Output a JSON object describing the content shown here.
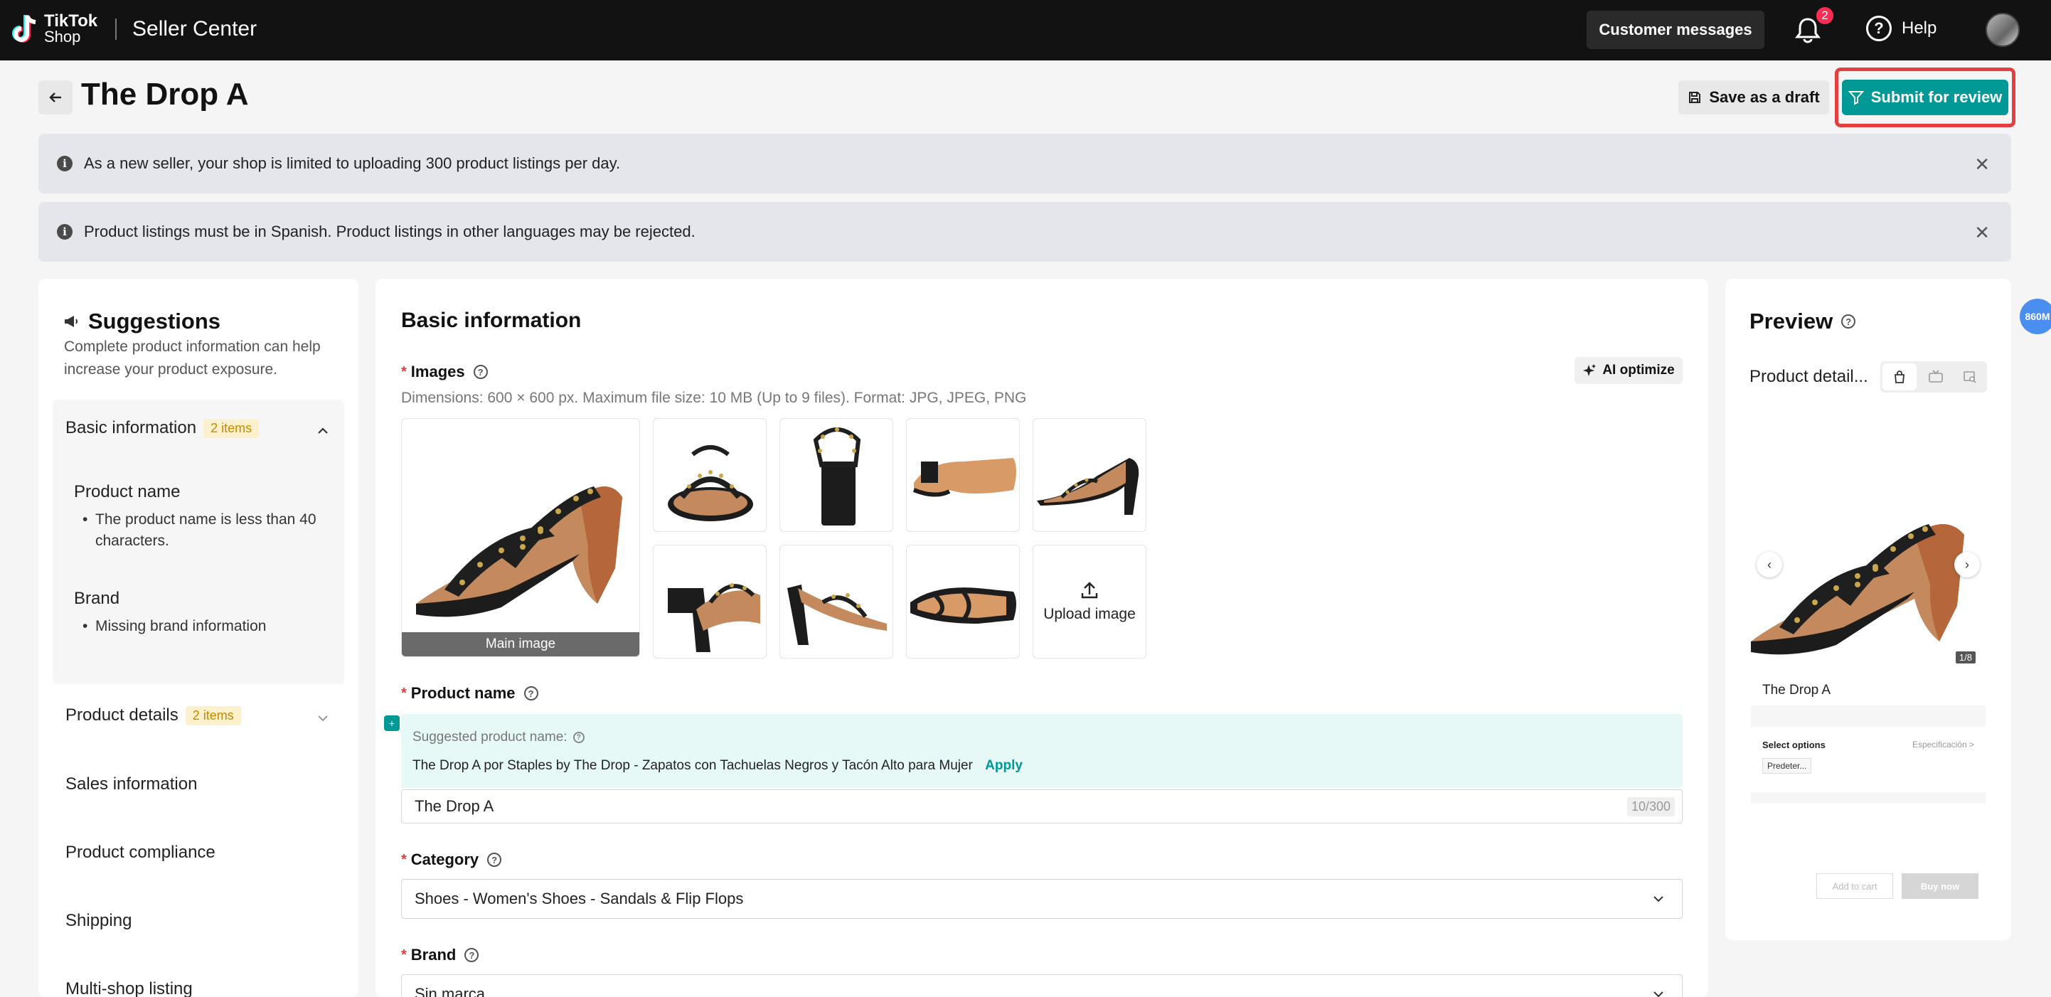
{
  "topbar": {
    "logo_line1": "TikTok",
    "logo_line2": "Shop",
    "app_name": "Seller Center",
    "customer_messages": "Customer messages",
    "notification_count": "2",
    "help": "Help",
    "bg_color": "#121212"
  },
  "header": {
    "title": "The Drop A",
    "save_draft": "Save as a draft",
    "submit": "Submit for review",
    "submit_color": "#009995",
    "highlight_color": "#e53e3e"
  },
  "banners": [
    {
      "text": "As a new seller, your shop is limited to uploading 300 product listings per day."
    },
    {
      "text": "Product listings must be in Spanish. Product listings in other languages may be rejected."
    }
  ],
  "suggestions": {
    "title": "Suggestions",
    "subtitle": "Complete product information can help increase your product exposure.",
    "basic": {
      "label": "Basic information",
      "badge": "2 items",
      "product_name_heading": "Product name",
      "product_name_tip": "The product name is less than 40 characters.",
      "brand_heading": "Brand",
      "brand_tip": "Missing brand information"
    },
    "product_details": {
      "label": "Product details",
      "badge": "2 items"
    },
    "nav": [
      "Sales information",
      "Product compliance",
      "Shipping",
      "Multi-shop listing"
    ]
  },
  "basic_info": {
    "title": "Basic information",
    "images_label": "Images",
    "dimensions": "Dimensions: 600 × 600 px. Maximum file size: 10 MB (Up to 9 files). Format: JPG, JPEG, PNG",
    "ai_optimize": "AI optimize",
    "main_image_label": "Main image",
    "upload_image": "Upload image",
    "product_name_label": "Product name",
    "suggested_label": "Suggested product name:",
    "suggested_name": "The Drop A por Staples by The Drop - Zapatos con Tachuelas Negros y Tacón Alto para Mujer",
    "apply": "Apply",
    "product_name_value": "The Drop A",
    "product_name_counter": "10/300",
    "category_label": "Category",
    "category_value": "Shoes - Women's Shoes - Sandals & Flip Flops",
    "brand_label": "Brand",
    "brand_value": "Sin marca"
  },
  "preview": {
    "title": "Preview",
    "subtitle": "Product detail...",
    "pager": "1/8",
    "product_name": "The Drop A",
    "select_options": "Select options",
    "specification": "Especificación >",
    "chip": "Predeter...",
    "add_to_cart": "Add to cart",
    "buy_now": "Buy now"
  },
  "float_badge": "860M"
}
